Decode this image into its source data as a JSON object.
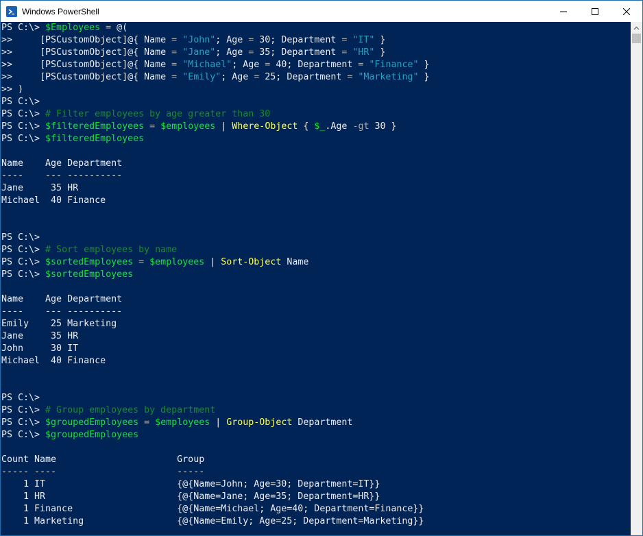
{
  "window": {
    "title": "Windows PowerShell",
    "icon": "powershell-icon",
    "controls": [
      "minimize-icon",
      "maximize-icon",
      "close-icon"
    ]
  },
  "colors": {
    "background": "#012456",
    "default": "#eeedf0",
    "variable": "#13e23c",
    "string": "#25a3c4",
    "command": "#ffff55",
    "comment": "#1a8a2e",
    "operator": "#a9a9a9"
  },
  "console": {
    "lines": [
      [
        [
          "def",
          "PS C:\\> "
        ],
        [
          "var",
          "$Employees"
        ],
        [
          "op",
          " = "
        ],
        [
          "def",
          "@("
        ]
      ],
      [
        [
          "def",
          ">>     [PSCustomObject]@{ Name "
        ],
        [
          "op",
          "= "
        ],
        [
          "str",
          "\"John\""
        ],
        [
          "def",
          "; Age "
        ],
        [
          "op",
          "= "
        ],
        [
          "def",
          "30; Department "
        ],
        [
          "op",
          "= "
        ],
        [
          "str",
          "\"IT\""
        ],
        [
          "def",
          " }"
        ]
      ],
      [
        [
          "def",
          ">>     [PSCustomObject]@{ Name "
        ],
        [
          "op",
          "= "
        ],
        [
          "str",
          "\"Jane\""
        ],
        [
          "def",
          "; Age "
        ],
        [
          "op",
          "= "
        ],
        [
          "def",
          "35; Department "
        ],
        [
          "op",
          "= "
        ],
        [
          "str",
          "\"HR\""
        ],
        [
          "def",
          " }"
        ]
      ],
      [
        [
          "def",
          ">>     [PSCustomObject]@{ Name "
        ],
        [
          "op",
          "= "
        ],
        [
          "str",
          "\"Michael\""
        ],
        [
          "def",
          "; Age "
        ],
        [
          "op",
          "= "
        ],
        [
          "def",
          "40; Department "
        ],
        [
          "op",
          "= "
        ],
        [
          "str",
          "\"Finance\""
        ],
        [
          "def",
          " }"
        ]
      ],
      [
        [
          "def",
          ">>     [PSCustomObject]@{ Name "
        ],
        [
          "op",
          "= "
        ],
        [
          "str",
          "\"Emily\""
        ],
        [
          "def",
          "; Age "
        ],
        [
          "op",
          "= "
        ],
        [
          "def",
          "25; Department "
        ],
        [
          "op",
          "= "
        ],
        [
          "str",
          "\"Marketing\""
        ],
        [
          "def",
          " }"
        ]
      ],
      [
        [
          "def",
          ">> )"
        ]
      ],
      [
        [
          "def",
          "PS C:\\>"
        ]
      ],
      [
        [
          "def",
          "PS C:\\> "
        ],
        [
          "cmt",
          "# Filter employees by age greater than 30"
        ]
      ],
      [
        [
          "def",
          "PS C:\\> "
        ],
        [
          "var",
          "$filteredEmployees"
        ],
        [
          "op",
          " = "
        ],
        [
          "var",
          "$employees"
        ],
        [
          "def",
          " | "
        ],
        [
          "cmd",
          "Where-Object"
        ],
        [
          "def",
          " { "
        ],
        [
          "var",
          "$_"
        ],
        [
          "def",
          ".Age "
        ],
        [
          "op",
          "-gt"
        ],
        [
          "def",
          " 30 }"
        ]
      ],
      [
        [
          "def",
          "PS C:\\> "
        ],
        [
          "var",
          "$filteredEmployees"
        ]
      ],
      [
        [
          "def",
          ""
        ]
      ],
      [
        [
          "def",
          "Name    Age Department"
        ]
      ],
      [
        [
          "def",
          "----    --- ----------"
        ]
      ],
      [
        [
          "def",
          "Jane     35 HR"
        ]
      ],
      [
        [
          "def",
          "Michael  40 Finance"
        ]
      ],
      [
        [
          "def",
          ""
        ]
      ],
      [
        [
          "def",
          ""
        ]
      ],
      [
        [
          "def",
          "PS C:\\>"
        ]
      ],
      [
        [
          "def",
          "PS C:\\> "
        ],
        [
          "cmt",
          "# Sort employees by name"
        ]
      ],
      [
        [
          "def",
          "PS C:\\> "
        ],
        [
          "var",
          "$sortedEmployees"
        ],
        [
          "op",
          " = "
        ],
        [
          "var",
          "$employees"
        ],
        [
          "def",
          " | "
        ],
        [
          "cmd",
          "Sort-Object"
        ],
        [
          "def",
          " Name"
        ]
      ],
      [
        [
          "def",
          "PS C:\\> "
        ],
        [
          "var",
          "$sortedEmployees"
        ]
      ],
      [
        [
          "def",
          ""
        ]
      ],
      [
        [
          "def",
          "Name    Age Department"
        ]
      ],
      [
        [
          "def",
          "----    --- ----------"
        ]
      ],
      [
        [
          "def",
          "Emily    25 Marketing"
        ]
      ],
      [
        [
          "def",
          "Jane     35 HR"
        ]
      ],
      [
        [
          "def",
          "John     30 IT"
        ]
      ],
      [
        [
          "def",
          "Michael  40 Finance"
        ]
      ],
      [
        [
          "def",
          ""
        ]
      ],
      [
        [
          "def",
          ""
        ]
      ],
      [
        [
          "def",
          "PS C:\\>"
        ]
      ],
      [
        [
          "def",
          "PS C:\\> "
        ],
        [
          "cmt",
          "# Group employees by department"
        ]
      ],
      [
        [
          "def",
          "PS C:\\> "
        ],
        [
          "var",
          "$groupedEmployees"
        ],
        [
          "op",
          " = "
        ],
        [
          "var",
          "$employees"
        ],
        [
          "def",
          " | "
        ],
        [
          "cmd",
          "Group-Object"
        ],
        [
          "def",
          " Department"
        ]
      ],
      [
        [
          "def",
          "PS C:\\> "
        ],
        [
          "var",
          "$groupedEmployees"
        ]
      ],
      [
        [
          "def",
          ""
        ]
      ],
      [
        [
          "def",
          "Count Name                      Group"
        ]
      ],
      [
        [
          "def",
          "----- ----                      -----"
        ]
      ],
      [
        [
          "def",
          "    1 IT                        {@{Name=John; Age=30; Department=IT}}"
        ]
      ],
      [
        [
          "def",
          "    1 HR                        {@{Name=Jane; Age=35; Department=HR}}"
        ]
      ],
      [
        [
          "def",
          "    1 Finance                   {@{Name=Michael; Age=40; Department=Finance}}"
        ]
      ],
      [
        [
          "def",
          "    1 Marketing                 {@{Name=Emily; Age=25; Department=Marketing}}"
        ]
      ]
    ]
  }
}
